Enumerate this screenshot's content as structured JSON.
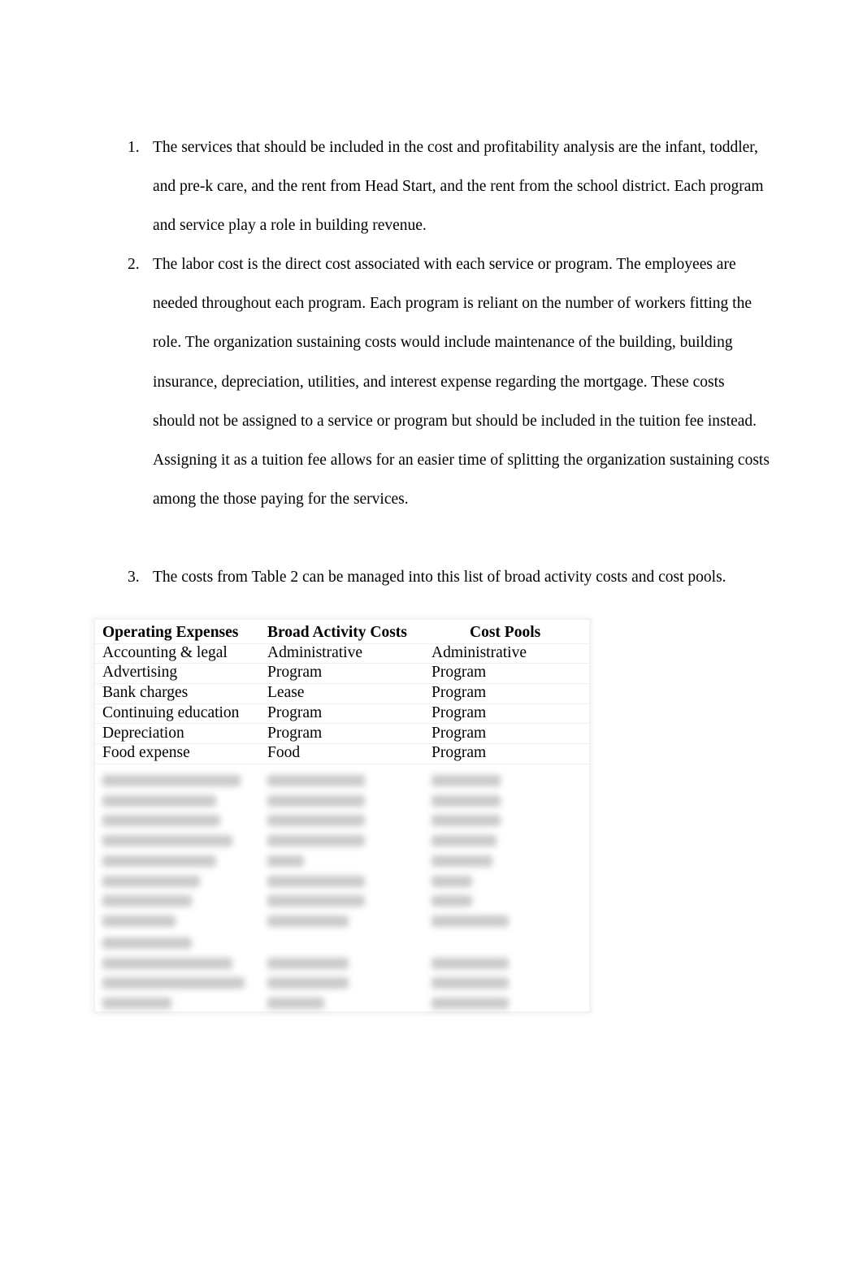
{
  "list": [
    {
      "number": "1.",
      "text": "The services that should be included in the cost and profitability analysis are the infant, toddler, and pre-k care, and the rent from Head Start, and the rent from the school district. Each program and service play a role in building revenue."
    },
    {
      "number": "2.",
      "text": "The labor cost is the direct cost associated with each service or program. The employees are needed throughout each program. Each program is reliant on the number of workers fitting the role. The organization sustaining costs would include maintenance of the building, building insurance, depreciation, utilities, and interest expense regarding the mortgage. These costs should not be assigned to a service or program but should be included in the tuition fee instead. Assigning it as a tuition fee allows for an easier time of splitting the organization sustaining costs among the those paying for the services."
    },
    {
      "number": "3.",
      "text": "The costs from Table 2 can be managed into this list of broad activity costs and cost pools."
    }
  ],
  "table": {
    "headers": [
      "Operating Expenses",
      "Broad Activity Costs",
      "Cost Pools"
    ],
    "rows": [
      [
        "Accounting & legal",
        "Administrative",
        "Administrative"
      ],
      [
        "Advertising",
        "Program",
        "Program"
      ],
      [
        "Bank charges",
        "Lease",
        "Program"
      ],
      [
        "Continuing education",
        "Program",
        "Program"
      ],
      [
        "Depreciation",
        "Program",
        "Program"
      ],
      [
        "Food expense",
        "Food",
        "Program"
      ]
    ],
    "blurred_rows": 12
  }
}
